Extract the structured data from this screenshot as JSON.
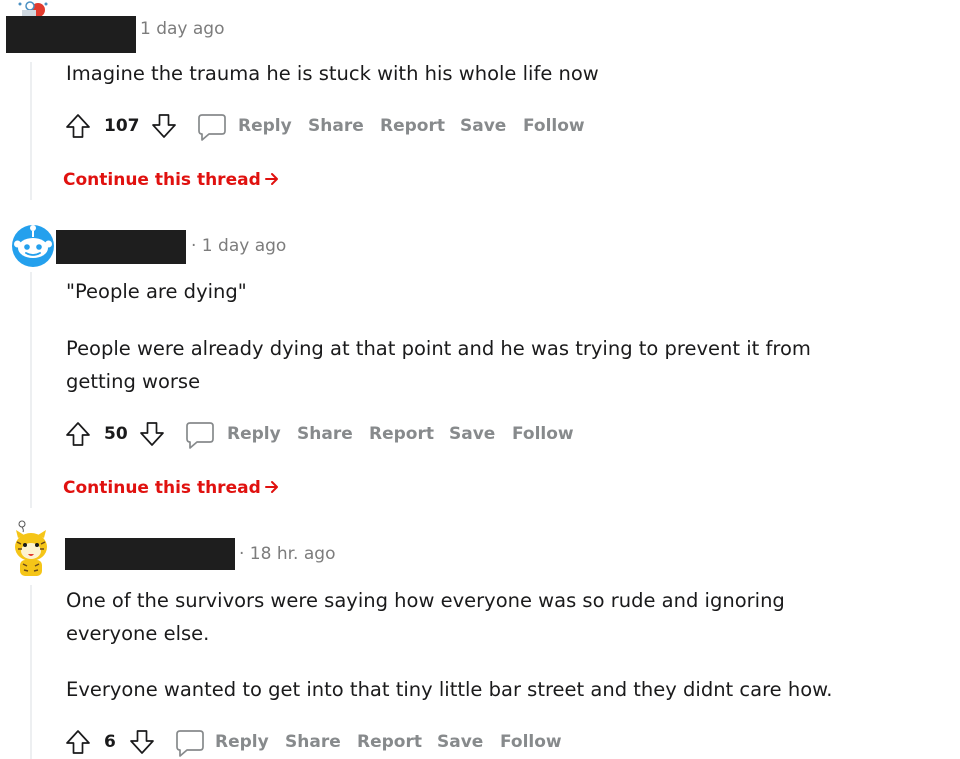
{
  "comments": [
    {
      "timestamp": "1 day ago",
      "body": [
        "Imagine the trauma he is stuck with his whole life now"
      ],
      "score": "107",
      "actions": {
        "reply": "Reply",
        "share": "Share",
        "report": "Report",
        "save": "Save",
        "follow": "Follow"
      },
      "continue_link": "Continue this thread"
    },
    {
      "timestamp": "· 1 day ago",
      "body": [
        "\"People are dying\"",
        "People were already dying at that point and he was trying to prevent it from",
        "getting worse"
      ],
      "score": "50",
      "actions": {
        "reply": "Reply",
        "share": "Share",
        "report": "Report",
        "save": "Save",
        "follow": "Follow"
      },
      "continue_link": "Continue this thread"
    },
    {
      "timestamp": "· 18 hr. ago",
      "body": [
        "One of the survivors were saying how everyone was so rude and ignoring",
        "everyone else.",
        "Everyone wanted to get into that tiny little bar street and they didnt care how."
      ],
      "score": "6",
      "actions": {
        "reply": "Reply",
        "share": "Share",
        "report": "Report",
        "save": "Save",
        "follow": "Follow"
      }
    }
  ],
  "colors": {
    "accent": "#e0110f",
    "muted": "#878a8c",
    "text": "#1a1a1b",
    "thread_line": "#edeff1"
  },
  "icons": [
    "upvote-icon",
    "downvote-icon",
    "comment-icon",
    "arrow-right-icon",
    "avatar-robot",
    "avatar-snoo",
    "avatar-tiger"
  ]
}
